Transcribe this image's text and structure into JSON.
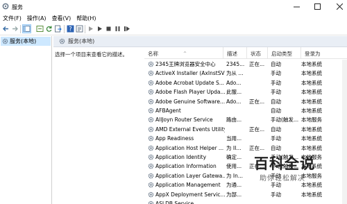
{
  "window": {
    "title": "服务"
  },
  "menu": [
    "文件(F)",
    "操作(A)",
    "查看(V)",
    "帮助(H)"
  ],
  "toolbar": [
    "back-arrow-icon",
    "forward-arrow-icon",
    "console-tree-icon",
    "show-hide-icon",
    "refresh-icon",
    "export-icon",
    "help-icon",
    "properties-icon",
    "play-icon",
    "play-selected-icon",
    "stop-icon",
    "pause-icon",
    "restart-icon"
  ],
  "tree": {
    "root_label": "服务(本地)"
  },
  "panel": {
    "title": "服务(本地)",
    "description_prompt": "选择一个项目来查看它的描述。"
  },
  "table": {
    "columns": [
      "名称",
      "描述",
      "状态",
      "启动类型",
      "登录为"
    ],
    "rows": [
      {
        "name": "2345王牌浏览器安全中心",
        "desc": "2345...",
        "status": "正在...",
        "startup": "自动",
        "logon": "本地系统"
      },
      {
        "name": "ActiveX Installer (AxInstSV)",
        "desc": "为从 ...",
        "status": "",
        "startup": "手动",
        "logon": "本地系统"
      },
      {
        "name": "Adobe Acrobat Update S...",
        "desc": "Ado...",
        "status": "",
        "startup": "手动",
        "logon": "本地系统"
      },
      {
        "name": "Adobe Flash Player Upda...",
        "desc": "此服...",
        "status": "",
        "startup": "手动",
        "logon": "本地系统"
      },
      {
        "name": "Adobe Genuine Software...",
        "desc": "Ado...",
        "status": "正在...",
        "startup": "自动",
        "logon": "本地系统"
      },
      {
        "name": "AFBAgent",
        "desc": "",
        "status": "",
        "startup": "自动",
        "logon": "本地系统"
      },
      {
        "name": "AllJoyn Router Service",
        "desc": "路由...",
        "status": "",
        "startup": "手动(触发...",
        "logon": "本地服务"
      },
      {
        "name": "AMD External Events Utility",
        "desc": "",
        "status": "正在...",
        "startup": "自动",
        "logon": "本地系统"
      },
      {
        "name": "App Readiness",
        "desc": "当用...",
        "status": "",
        "startup": "手动",
        "logon": "本地系统"
      },
      {
        "name": "Application Host Helper ...",
        "desc": "为 II...",
        "status": "正在...",
        "startup": "自动",
        "logon": "本地系统"
      },
      {
        "name": "Application Identity",
        "desc": "确定...",
        "status": "",
        "startup": "手动(触发...",
        "logon": "本地服务"
      },
      {
        "name": "Application Information",
        "desc": "使用...",
        "status": "正在...",
        "startup": "手动(触发...",
        "logon": "本地系统"
      },
      {
        "name": "Application Layer Gatewa...",
        "desc": "为 In...",
        "status": "",
        "startup": "手动",
        "logon": "本地服务"
      },
      {
        "name": "Application Management",
        "desc": "为通...",
        "status": "",
        "startup": "手动",
        "logon": "本地系统"
      },
      {
        "name": "AppX Deployment Servic...",
        "desc": "为部...",
        "status": "",
        "startup": "手动",
        "logon": "本地系统"
      },
      {
        "name": "ASLDB Service",
        "desc": "",
        "status": "",
        "startup": "",
        "logon": ""
      }
    ]
  },
  "watermark": {
    "main": "百科全说",
    "sub": "助你轻松解决"
  }
}
